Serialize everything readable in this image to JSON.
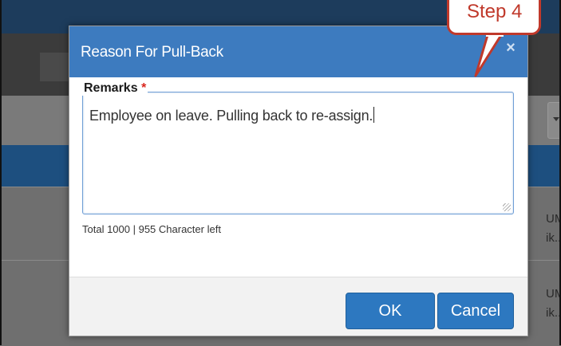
{
  "background": {
    "row_texts": [
      [
        "UMA",
        "ik..."
      ],
      [
        "UMA",
        "ik..."
      ]
    ]
  },
  "dialog": {
    "title": "Reason For Pull-Back",
    "close_symbol": "×",
    "remarks": {
      "label": "Remarks",
      "required_mark": "*",
      "value": "Employee on leave. Pulling back to re-assign."
    },
    "char_count": "Total 1000 | 955 Character left",
    "buttons": {
      "ok": "OK",
      "cancel": "Cancel"
    }
  },
  "callout": {
    "text": "Step 4"
  },
  "colors": {
    "header_blue": "#3d7bbf",
    "button_blue": "#2d78c0",
    "callout_red": "#c0392b",
    "required_red": "#d9251c"
  },
  "icons": {
    "close": "close-icon",
    "resize": "resize-grip-icon",
    "dropdown": "chevron-down-icon"
  }
}
